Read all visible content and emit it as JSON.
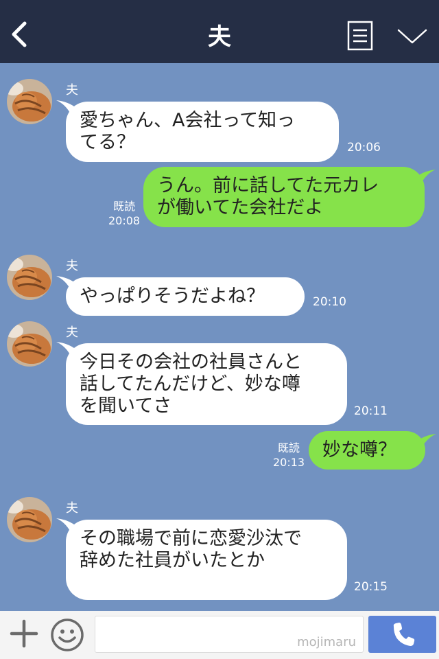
{
  "header": {
    "title": "夫",
    "back_icon": "chevron-left-icon",
    "notes_icon": "notes-icon",
    "menu_icon": "chevron-down-icon"
  },
  "colors": {
    "header_bg": "#252e45",
    "chat_bg": "#7292c1",
    "incoming_bubble": "#ffffff",
    "outgoing_bubble": "#86e24a",
    "call_button": "#5b82d6"
  },
  "messages": [
    {
      "direction": "in",
      "sender": "夫",
      "text": "愛ちゃん、A会社って知っ\nてる？",
      "time": "20:06"
    },
    {
      "direction": "out",
      "read": "既読",
      "time": "20:08",
      "text": "うん。前に話してた元カレ\nが働いてた会社だよ"
    },
    {
      "direction": "in",
      "sender": "夫",
      "text": "やっぱりそうだよね？",
      "time": "20:10"
    },
    {
      "direction": "in",
      "sender": "夫",
      "text": "今日その会社の社員さんと\n話してたんだけど、妙な噂\nを聞いてさ",
      "time": "20:11"
    },
    {
      "direction": "out",
      "read": "既読",
      "time": "20:13",
      "text": "妙な噂？"
    },
    {
      "direction": "in",
      "sender": "夫",
      "text": "その職場で前に恋愛沙汰で\n辞めた社員がいたとか",
      "time": "20:15"
    }
  ],
  "input": {
    "placeholder": "",
    "watermark": "mojimaru",
    "plus_icon": "plus-icon",
    "emoji_icon": "smiley-icon",
    "call_icon": "phone-icon"
  }
}
